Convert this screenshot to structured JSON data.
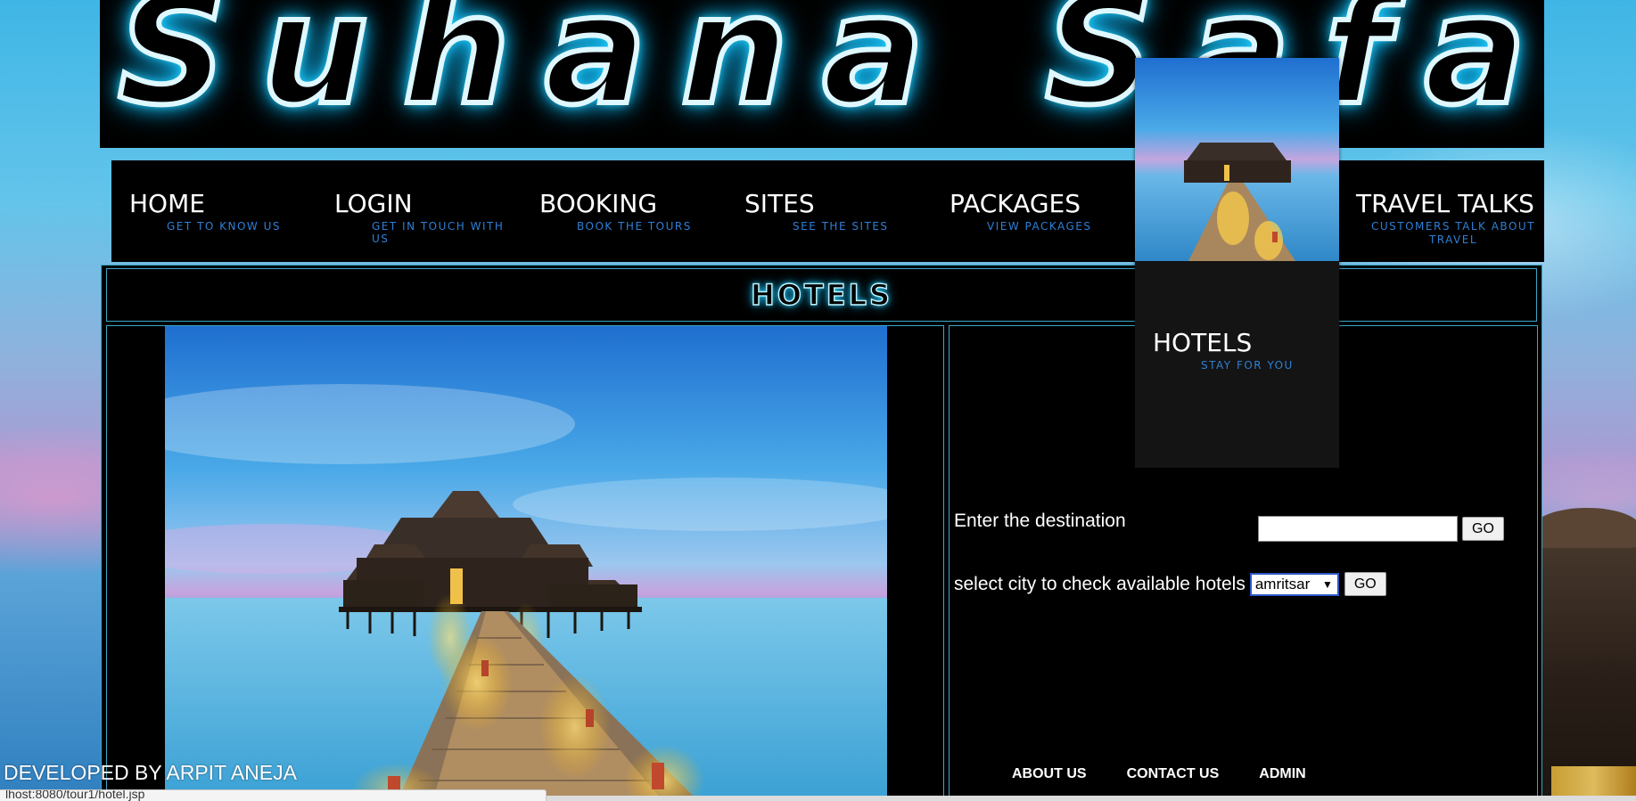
{
  "banner": {
    "text": "Suhana Safar"
  },
  "nav": {
    "items": [
      {
        "label": "HOME",
        "sub": "GET TO KNOW US"
      },
      {
        "label": "LOGIN",
        "sub": "GET IN TOUCH WITH US"
      },
      {
        "label": "BOOKING",
        "sub": "BOOK THE TOURS"
      },
      {
        "label": "SITES",
        "sub": "SEE THE SITES"
      },
      {
        "label": "PACKAGES",
        "sub": "VIEW PACKAGES"
      },
      {
        "label": "TRAVEL TALKS",
        "sub": "CUSTOMERS TALK ABOUT TRAVEL"
      }
    ],
    "dropdown": {
      "label": "HOTELS",
      "sub": "STAY FOR YOU"
    }
  },
  "page": {
    "title": "HOTELS"
  },
  "form": {
    "destination_label": "Enter the destination",
    "destination_value": "",
    "go_label": "GO",
    "city_label": "select city to check available hotels",
    "city_selected": "amritsar",
    "city_go_label": "GO"
  },
  "footer": {
    "links": [
      "ABOUT US",
      "CONTACT US",
      "ADMIN"
    ],
    "developer": "DEVELOPED BY ARPIT ANEJA"
  },
  "status_bar": {
    "url": "lhost:8080/tour1/hotel.jsp"
  },
  "colors": {
    "neon": "#2fd9ff",
    "nav_sub": "#2e7fd6",
    "border": "#3aa7c9"
  }
}
